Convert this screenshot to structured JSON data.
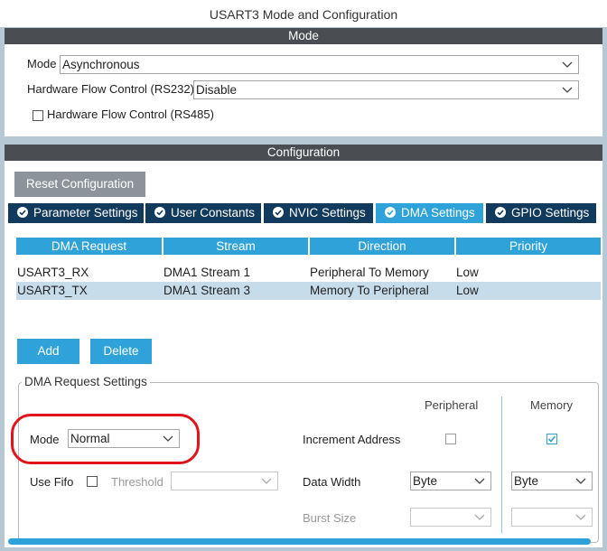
{
  "window": {
    "title": "USART3 Mode and Configuration"
  },
  "mode_section": {
    "header": "Mode",
    "mode_label": "Mode",
    "mode_value": "Asynchronous",
    "hw_flow_label": "Hardware Flow Control (RS232)",
    "hw_flow_value": "Disable",
    "rs485_label": "Hardware Flow Control (RS485)",
    "rs485_checked": false
  },
  "config_section": {
    "header": "Configuration",
    "reset_button": "Reset Configuration",
    "tabs": [
      {
        "label": "Parameter Settings",
        "icon": "check-circle-icon",
        "active": false
      },
      {
        "label": "User Constants",
        "icon": "check-circle-icon",
        "active": false
      },
      {
        "label": "NVIC Settings",
        "icon": "check-circle-icon",
        "active": false
      },
      {
        "label": "DMA Settings",
        "icon": "check-circle-icon",
        "active": true
      },
      {
        "label": "GPIO Settings",
        "icon": "check-circle-icon",
        "active": false
      }
    ]
  },
  "dma_table": {
    "columns": [
      "DMA Request",
      "Stream",
      "Direction",
      "Priority"
    ],
    "rows": [
      [
        "USART3_RX",
        "DMA1 Stream 1",
        "Peripheral To Memory",
        "Low"
      ],
      [
        "USART3_TX",
        "DMA1 Stream 3",
        "Memory To Peripheral",
        "Low"
      ]
    ],
    "selected_row": 1
  },
  "actions": {
    "add": "Add",
    "delete": "Delete"
  },
  "dma_settings": {
    "legend": "DMA Request Settings",
    "peripheral_header": "Peripheral",
    "memory_header": "Memory",
    "mode_label": "Mode",
    "mode_value": "Normal",
    "increment_label": "Increment Address",
    "increment_peripheral": false,
    "increment_memory": true,
    "use_fifo_label": "Use Fifo",
    "use_fifo_checked": false,
    "threshold_label": "Threshold",
    "threshold_value": "",
    "data_width_label": "Data Width",
    "data_width_peripheral": "Byte",
    "data_width_memory": "Byte",
    "burst_size_label": "Burst Size",
    "burst_peripheral": "",
    "burst_memory": ""
  },
  "colors": {
    "accent": "#2fa3d9",
    "tab_dark": "#113a5c",
    "section_bar": "#4a4d51",
    "selected_row": "#c7dceb",
    "highlight": "#e0141a"
  }
}
